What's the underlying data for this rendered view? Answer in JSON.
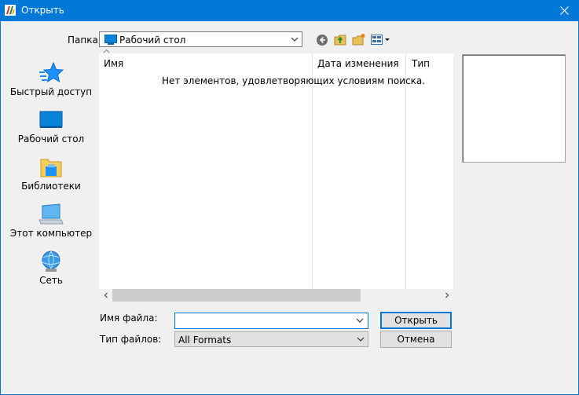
{
  "window": {
    "title": "Открыть"
  },
  "toolbar": {
    "folder_label": "Папка:",
    "folder_value": "Рабочий стол"
  },
  "places": [
    {
      "label": "Быстрый доступ",
      "icon": "star-icon"
    },
    {
      "label": "Рабочий стол",
      "icon": "desktop-icon"
    },
    {
      "label": "Библиотеки",
      "icon": "libraries-icon"
    },
    {
      "label": "Этот компьютер",
      "icon": "computer-icon"
    },
    {
      "label": "Сеть",
      "icon": "network-icon"
    }
  ],
  "filelist": {
    "columns": [
      "Имя",
      "Дата изменения",
      "Тип"
    ],
    "empty_message": "Нет элементов, удовлетворяющих условиям поиска."
  },
  "fields": {
    "filename_label": "Имя файла:",
    "filename_value": "",
    "filetype_label": "Тип файлов:",
    "filetype_value": "All Formats"
  },
  "buttons": {
    "open": "Открыть",
    "cancel": "Отмена"
  },
  "colors": {
    "accent": "#0078d7",
    "background": "#f0f0f0",
    "star": "#1e90ff"
  }
}
